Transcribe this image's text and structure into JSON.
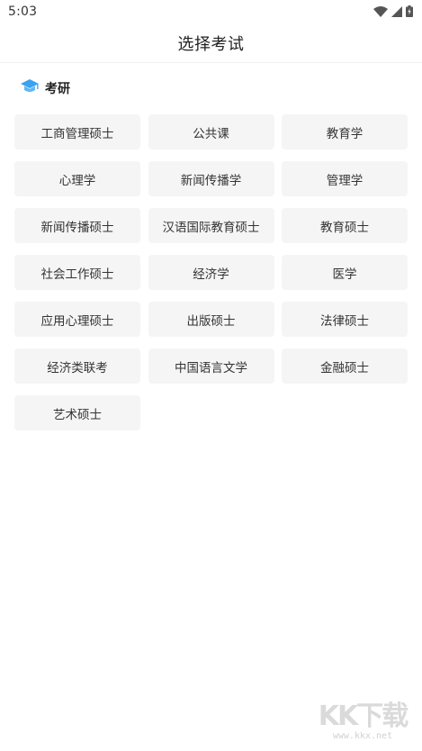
{
  "status_bar": {
    "time": "5:03",
    "icons": [
      "wifi-icon",
      "signal-icon",
      "battery-icon"
    ]
  },
  "header": {
    "title": "选择考试"
  },
  "section": {
    "title": "考研",
    "icon": "graduation-cap-icon",
    "icon_color": "#3ba1f0"
  },
  "options": [
    {
      "label": "工商管理硕士"
    },
    {
      "label": "公共课"
    },
    {
      "label": "教育学"
    },
    {
      "label": "心理学"
    },
    {
      "label": "新闻传播学"
    },
    {
      "label": "管理学"
    },
    {
      "label": "新闻传播硕士"
    },
    {
      "label": "汉语国际教育硕士"
    },
    {
      "label": "教育硕士"
    },
    {
      "label": "社会工作硕士"
    },
    {
      "label": "经济学"
    },
    {
      "label": "医学"
    },
    {
      "label": "应用心理硕士"
    },
    {
      "label": "出版硕士"
    },
    {
      "label": "法律硕士"
    },
    {
      "label": "经济类联考"
    },
    {
      "label": "中国语言文学"
    },
    {
      "label": "金融硕士"
    },
    {
      "label": "艺术硕士"
    }
  ],
  "watermark": {
    "logo": "KK下载",
    "url": "www.kkx.net"
  }
}
